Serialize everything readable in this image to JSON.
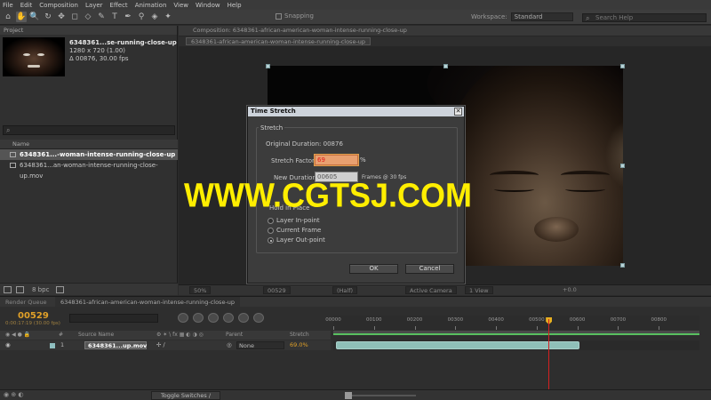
{
  "menu": [
    "File",
    "Edit",
    "Composition",
    "Layer",
    "Effect",
    "Animation",
    "View",
    "Window",
    "Help"
  ],
  "toolbar": {
    "tools": [
      "⌂",
      "✋",
      "🔍",
      "↻",
      "✥",
      "◻",
      "◇",
      "✎",
      "T",
      "✒",
      "⚲",
      "◈",
      "✦"
    ],
    "snapping_label": "Snapping",
    "workspace_label": "Workspace:",
    "workspace_value": "Standard",
    "search_placeholder": "Search Help"
  },
  "project": {
    "tab_label": "Project",
    "file_name": "6348361...se-running-close-up",
    "file_dims": "1280 x 720 (1.00)",
    "file_duration": "Δ 00876, 30.00 fps",
    "col_name": "Name",
    "items": [
      {
        "name": "6348361...-woman-intense-running-close-up",
        "selected": true
      },
      {
        "name": "6348361...an-woman-intense-running-close-up.mov",
        "selected": false
      }
    ],
    "bpc": "8 bpc"
  },
  "composition": {
    "tab_label": "Composition: 6348361-african-american-woman-intense-running-close-up",
    "crumb": "6348361-african-american-woman-intense-running-close-up",
    "zoom": "50%",
    "frame": "00529",
    "resolution": "(Half)",
    "camera": "Active Camera",
    "views": "1 View",
    "exposure": "+0.0"
  },
  "dialog": {
    "title": "Time Stretch",
    "close": "✕",
    "group_label": "Stretch",
    "original_duration_label": "Original Duration:",
    "original_duration_value": "00876",
    "stretch_factor_label": "Stretch Factor:",
    "stretch_factor_value": "69",
    "new_duration_label": "New Duration:",
    "new_duration_value": "00605",
    "fps_note": "Frames @ 30 fps",
    "hold_label": "Hold in Place",
    "options": [
      "Layer In-point",
      "Current Frame",
      "Layer Out-point"
    ],
    "selected_option": 2,
    "ok_label": "OK",
    "cancel_label": "Cancel"
  },
  "timeline": {
    "render_queue_tab": "Render Queue",
    "comp_tab": "6348361-african-american-woman-intense-running-close-up",
    "timecode": "00529",
    "timecode_sub": "0:00:17:19 (30.00 fps)",
    "col_hash": "#",
    "col_source": "Source Name",
    "col_parent": "Parent",
    "col_stretch": "Stretch",
    "layer": {
      "index": "1",
      "name": "6348361...up.mov",
      "parent": "None",
      "stretch": "69.0%"
    },
    "ruler_ticks": [
      "00000",
      "00100",
      "00200",
      "00300",
      "00400",
      "00500",
      "00600",
      "00700",
      "00800"
    ],
    "clip_end_frame": 605,
    "current_frame": 529,
    "ruler_max": 900,
    "toggle_label": "Toggle Switches / Modes"
  },
  "watermark": "WWW.CGTSJ.COM"
}
